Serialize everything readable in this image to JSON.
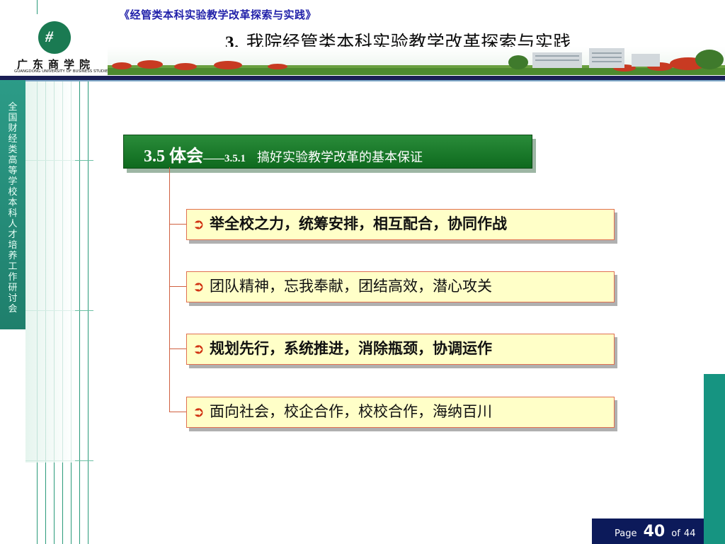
{
  "header": {
    "series_title": "《经管类本科实验教学改革探索与实践》",
    "slide_number": "3.",
    "slide_title": "我院经管类本科实验教学改革探索与实践"
  },
  "logo": {
    "mark": "ꟻ",
    "name_cn": "广东商学院",
    "name_en": "GUANGDONG UNIVERSITY OF BUSINESS STUDIES"
  },
  "left_strip": {
    "text": "全国财经类高等学校本科人才培养工作研讨会"
  },
  "section": {
    "main": "3.5  体会",
    "dash": "——",
    "num": "3.5.1",
    "sub": "搞好实验教学改革的基本保证"
  },
  "points": [
    {
      "arrow": "➲",
      "text": "举全校之力，统筹安排，相互配合，协同作战"
    },
    {
      "arrow": "➲",
      "text": "团队精神，忘我奉献，团结高效，潜心攻关"
    },
    {
      "arrow": "➲",
      "text": "规划先行，系统推进，消除瓶颈，协调运作"
    },
    {
      "arrow": "➲",
      "text": "面向社会，校企合作，校校合作，海纳百川"
    }
  ],
  "pager": {
    "label": "Page",
    "current": "40",
    "of": "of",
    "total": "44"
  },
  "colors": {
    "accent_green": "#169481",
    "header_navy": "#1a1e55",
    "heading_green": "#1e7a2c",
    "point_bg": "#ffffc8",
    "point_border": "#e07050"
  }
}
